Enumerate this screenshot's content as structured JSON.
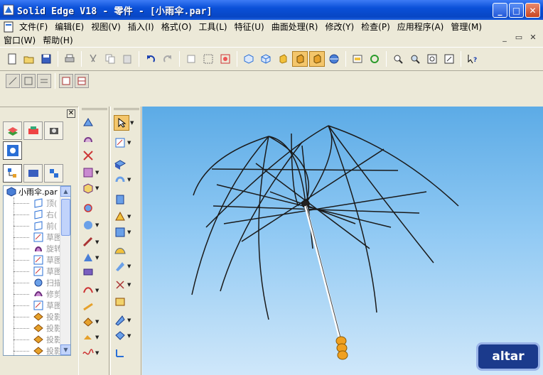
{
  "window": {
    "title": "Solid Edge V18 - 零件 - [小雨伞.par]",
    "buttons": [
      "_",
      "□",
      "✕"
    ]
  },
  "menu": {
    "row1": [
      "文件(F)",
      "编辑(E)",
      "视图(V)",
      "插入(I)",
      "格式(O)",
      "工具(L)",
      "特征(U)",
      "曲面处理(R)",
      "修改(Y)",
      "检查(P)",
      "应用程序(A)",
      "管理(M)"
    ],
    "row2": [
      "窗口(W)",
      "帮助(H)"
    ],
    "mdi": [
      "_",
      "▭",
      "✕"
    ]
  },
  "tree": {
    "root": "小雨伞.par",
    "items": [
      {
        "label": "顶(",
        "icon": "plane-icon"
      },
      {
        "label": "右(",
        "icon": "plane-icon"
      },
      {
        "label": "前(",
        "icon": "plane-icon"
      },
      {
        "label": "草图",
        "icon": "sketch-icon"
      },
      {
        "label": "旋转",
        "icon": "revolve-icon"
      },
      {
        "label": "草图",
        "icon": "sketch-icon"
      },
      {
        "label": "草图",
        "icon": "sketch-icon"
      },
      {
        "label": "扫描",
        "icon": "sweep-icon"
      },
      {
        "label": "修剪",
        "icon": "trim-icon"
      },
      {
        "label": "草图",
        "icon": "sketch-icon"
      },
      {
        "label": "投影",
        "icon": "project-icon"
      },
      {
        "label": "投影",
        "icon": "project-icon"
      },
      {
        "label": "投影",
        "icon": "project-icon"
      },
      {
        "label": "投影",
        "icon": "project-icon"
      }
    ]
  },
  "watermark": "altar",
  "colors": {
    "title_bar": "#0a50d8",
    "viewport_top": "#5cabe6",
    "viewport_bottom": "#cfe7fa",
    "handle": "#f0a020"
  }
}
